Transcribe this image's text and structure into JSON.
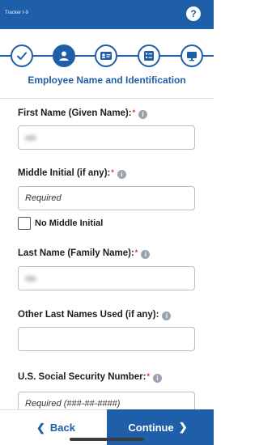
{
  "app": {
    "title": "Tracker I-9"
  },
  "header": {
    "help_label": "?"
  },
  "stepper": {
    "title": "Employee Name and Identification",
    "steps": [
      {
        "icon": "checkmark-icon",
        "state": "completed"
      },
      {
        "icon": "person-icon",
        "state": "active"
      },
      {
        "icon": "id-card-icon",
        "state": "pending"
      },
      {
        "icon": "checklist-icon",
        "state": "pending"
      },
      {
        "icon": "monitor-icon",
        "state": "pending"
      }
    ]
  },
  "form": {
    "first_name": {
      "label": "First Name (Given Name):",
      "required_mark": "*",
      "value": ""
    },
    "middle_initial": {
      "label": "Middle Initial (if any):",
      "required_mark": "*",
      "placeholder": "Required"
    },
    "no_middle_initial": {
      "label": "No Middle Initial",
      "checked": false
    },
    "last_name": {
      "label": "Last Name (Family Name):",
      "required_mark": "*",
      "value": ""
    },
    "other_last_names": {
      "label": "Other Last Names Used (if any):",
      "value": ""
    },
    "ssn": {
      "label": "U.S. Social Security Number:",
      "required_mark": "*",
      "placeholder": "Required (###-##-####)"
    }
  },
  "footer": {
    "back_label": "Back",
    "continue_label": "Continue"
  },
  "colors": {
    "primary": "#1f5fa9",
    "required": "#d52b1e"
  }
}
